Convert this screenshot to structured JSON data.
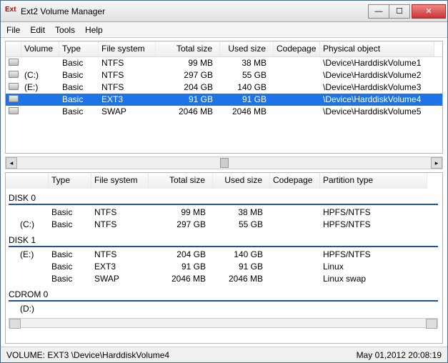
{
  "window": {
    "title": "Ext2 Volume Manager",
    "icon_text": "Ext"
  },
  "menu": {
    "file": "File",
    "edit": "Edit",
    "tools": "Tools",
    "help": "Help"
  },
  "top_headers": [
    "",
    "Volume",
    "Type",
    "File system",
    "Total size",
    "Used size",
    "Codepage",
    "Physical object"
  ],
  "top_rows": [
    {
      "vol": "",
      "type": "Basic",
      "fs": "NTFS",
      "total": "99 MB",
      "used": "38 MB",
      "cp": "",
      "obj": "\\Device\\HarddiskVolume1",
      "selected": false
    },
    {
      "vol": "(C:)",
      "type": "Basic",
      "fs": "NTFS",
      "total": "297 GB",
      "used": "55 GB",
      "cp": "",
      "obj": "\\Device\\HarddiskVolume2",
      "selected": false
    },
    {
      "vol": "(E:)",
      "type": "Basic",
      "fs": "NTFS",
      "total": "204 GB",
      "used": "140 GB",
      "cp": "",
      "obj": "\\Device\\HarddiskVolume3",
      "selected": false
    },
    {
      "vol": "",
      "type": "Basic",
      "fs": "EXT3",
      "total": "91 GB",
      "used": "91 GB",
      "cp": "",
      "obj": "\\Device\\HarddiskVolume4",
      "selected": true
    },
    {
      "vol": "",
      "type": "Basic",
      "fs": "SWAP",
      "total": "2046 MB",
      "used": "2046 MB",
      "cp": "",
      "obj": "\\Device\\HarddiskVolume5",
      "selected": false
    }
  ],
  "bottom_headers": [
    "",
    "Type",
    "File system",
    "Total size",
    "Used size",
    "Codepage",
    "Partition type"
  ],
  "groups": [
    {
      "label": "DISK 0",
      "rows": [
        {
          "vol": "",
          "type": "Basic",
          "fs": "NTFS",
          "total": "99 MB",
          "used": "38 MB",
          "cp": "",
          "pt": "HPFS/NTFS"
        },
        {
          "vol": "(C:)",
          "type": "Basic",
          "fs": "NTFS",
          "total": "297 GB",
          "used": "55 GB",
          "cp": "",
          "pt": "HPFS/NTFS"
        }
      ]
    },
    {
      "label": "DISK 1",
      "rows": [
        {
          "vol": "(E:)",
          "type": "Basic",
          "fs": "NTFS",
          "total": "204 GB",
          "used": "140 GB",
          "cp": "",
          "pt": "HPFS/NTFS"
        },
        {
          "vol": "",
          "type": "Basic",
          "fs": "EXT3",
          "total": "91 GB",
          "used": "91 GB",
          "cp": "",
          "pt": "Linux"
        },
        {
          "vol": "",
          "type": "Basic",
          "fs": "SWAP",
          "total": "2046 MB",
          "used": "2046 MB",
          "cp": "",
          "pt": "Linux swap"
        }
      ]
    },
    {
      "label": "CDROM 0",
      "rows": [
        {
          "vol": "(D:)",
          "type": "",
          "fs": "",
          "total": "",
          "used": "",
          "cp": "",
          "pt": ""
        }
      ]
    }
  ],
  "status": {
    "left": "VOLUME:  EXT3 \\Device\\HarddiskVolume4",
    "right": "May 01,2012 20:08:19"
  }
}
